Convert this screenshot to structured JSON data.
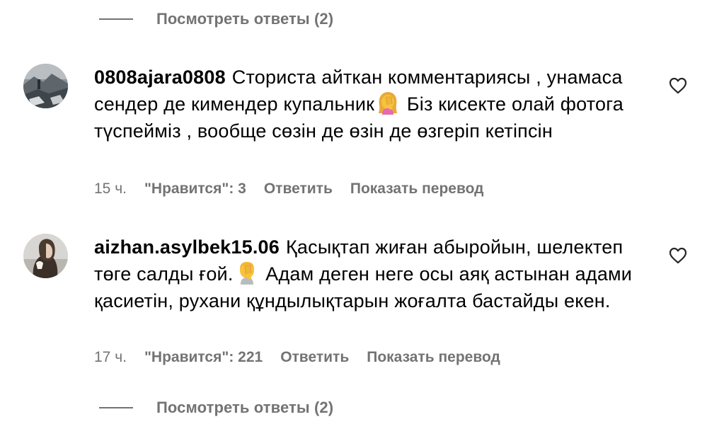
{
  "top_view_replies": {
    "label": "Посмотреть ответы (2)"
  },
  "comments": [
    {
      "username": "0808ajara0808",
      "text_before": "Сториста айткан комментариясы , унамаса сендер де кимендер купальник",
      "emoji": "woman-facepalming",
      "text_after": " Біз кисекте олай фотога түспейміз , вообще сөзін де өзін де өзгеріп кетіпсін",
      "time": "15 ч.",
      "likes": "\"Нравится\": 3",
      "reply": "Ответить",
      "translate": "Показать перевод"
    },
    {
      "username": "aizhan.asylbek15.06",
      "text_before": "Қасықтап жиған абыройын, шелектеп төге салды ғой.",
      "emoji": "person-facepalming",
      "text_after": "  Адам деген неге осы аяқ астынан адами қасиетін, рухани құндылықтарын жоғалта бастайды екен.",
      "time": "17 ч.",
      "likes": "\"Нравится\": 221",
      "reply": "Ответить",
      "translate": "Показать перевод"
    }
  ],
  "bottom_view_replies": {
    "label": "Посмотреть ответы (2)"
  },
  "colors": {
    "secondary_text": "#737373",
    "primary_text": "#000000",
    "emoji_yellow": "#f7c23c"
  }
}
